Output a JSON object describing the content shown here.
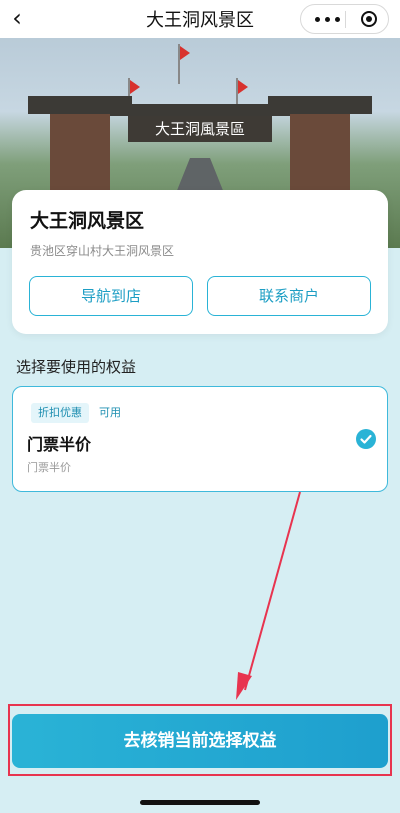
{
  "nav": {
    "title": "大王洞风景区"
  },
  "hero": {
    "sign_text": "大王洞風景區"
  },
  "venue": {
    "name": "大王洞风景区",
    "address": "贵池区穿山村大王洞风景区",
    "navigate_label": "导航到店",
    "contact_label": "联系商户"
  },
  "benefits": {
    "section_title": "选择要使用的权益",
    "items": [
      {
        "tag": "折扣优惠",
        "status": "可用",
        "name": "门票半价",
        "desc": "门票半价",
        "selected": true
      }
    ]
  },
  "action": {
    "confirm_label": "去核销当前选择权益"
  },
  "colors": {
    "accent": "#2ab3d6",
    "highlight": "#e8344f"
  }
}
